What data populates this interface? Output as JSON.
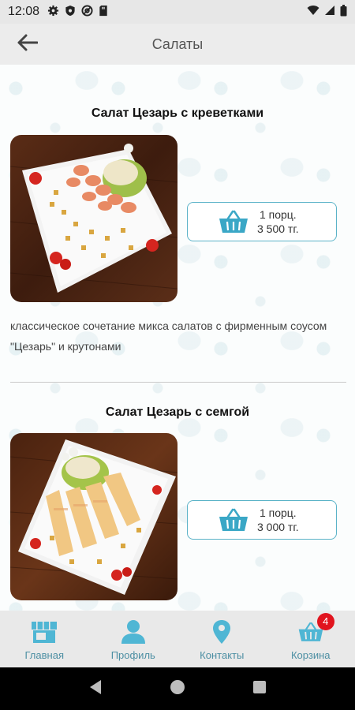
{
  "status_bar": {
    "time": "12:08",
    "icons": [
      "gear-icon",
      "shield-icon",
      "at-icon",
      "sd-card-icon",
      "wifi-icon",
      "signal-icon",
      "battery-icon"
    ]
  },
  "app_bar": {
    "title": "Салаты",
    "back_icon": "arrow-left-icon"
  },
  "products": [
    {
      "title": "Салат Цезарь с креветками",
      "price_line1": "1 порц.",
      "price_line2": "3 500 тг.",
      "description": "классическое сочетание микса салатов с фирменным соусом \"Цезарь\" и крутонами"
    },
    {
      "title": "Салат Цезарь с семгой",
      "price_line1": "1 порц.",
      "price_line2": "3 000 тг."
    }
  ],
  "bottom_nav": {
    "items": [
      {
        "label": "Главная",
        "icon": "store-icon"
      },
      {
        "label": "Профиль",
        "icon": "person-icon"
      },
      {
        "label": "Контакты",
        "icon": "location-pin-icon"
      },
      {
        "label": "Корзина",
        "icon": "basket-icon",
        "badge": "4"
      }
    ]
  },
  "colors": {
    "accent": "#5bb3c8",
    "nav_label": "#4d8fa3",
    "badge": "#e1141e"
  }
}
